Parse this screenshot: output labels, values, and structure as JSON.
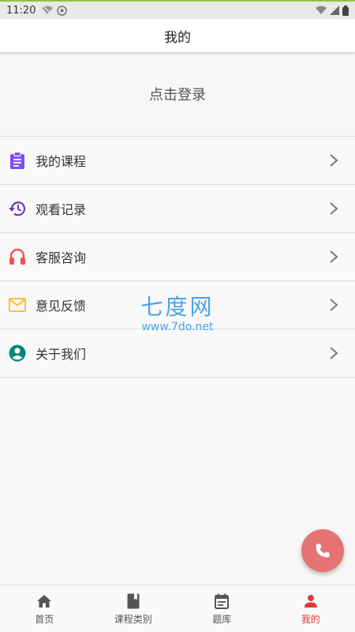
{
  "status_bar": {
    "time": "11:20"
  },
  "app_bar": {
    "title": "我的"
  },
  "login": {
    "label": "点击登录"
  },
  "menu": [
    {
      "label": "我的课程",
      "icon": "clipboard-icon",
      "color": "#7c4dff"
    },
    {
      "label": "观看记录",
      "icon": "history-icon",
      "color": "#673ab7"
    },
    {
      "label": "客服咨询",
      "icon": "headset-icon",
      "color": "#ef5350"
    },
    {
      "label": "意见反馈",
      "icon": "mail-icon",
      "color": "#fbc02d"
    },
    {
      "label": "关于我们",
      "icon": "account-circle-icon",
      "color": "#00897b"
    }
  ],
  "watermark": {
    "title": "七度网",
    "url": "www.7do.net"
  },
  "fab": {
    "icon": "phone-icon",
    "color": "#e57373"
  },
  "bottom_nav": [
    {
      "label": "首页",
      "icon": "home-icon",
      "active": false
    },
    {
      "label": "课程类别",
      "icon": "book-icon",
      "active": false
    },
    {
      "label": "题库",
      "icon": "event-note-icon",
      "active": false
    },
    {
      "label": "我的",
      "icon": "person-icon",
      "active": true
    }
  ],
  "colors": {
    "active": "#e53935",
    "inactive_icon": "#555555"
  }
}
